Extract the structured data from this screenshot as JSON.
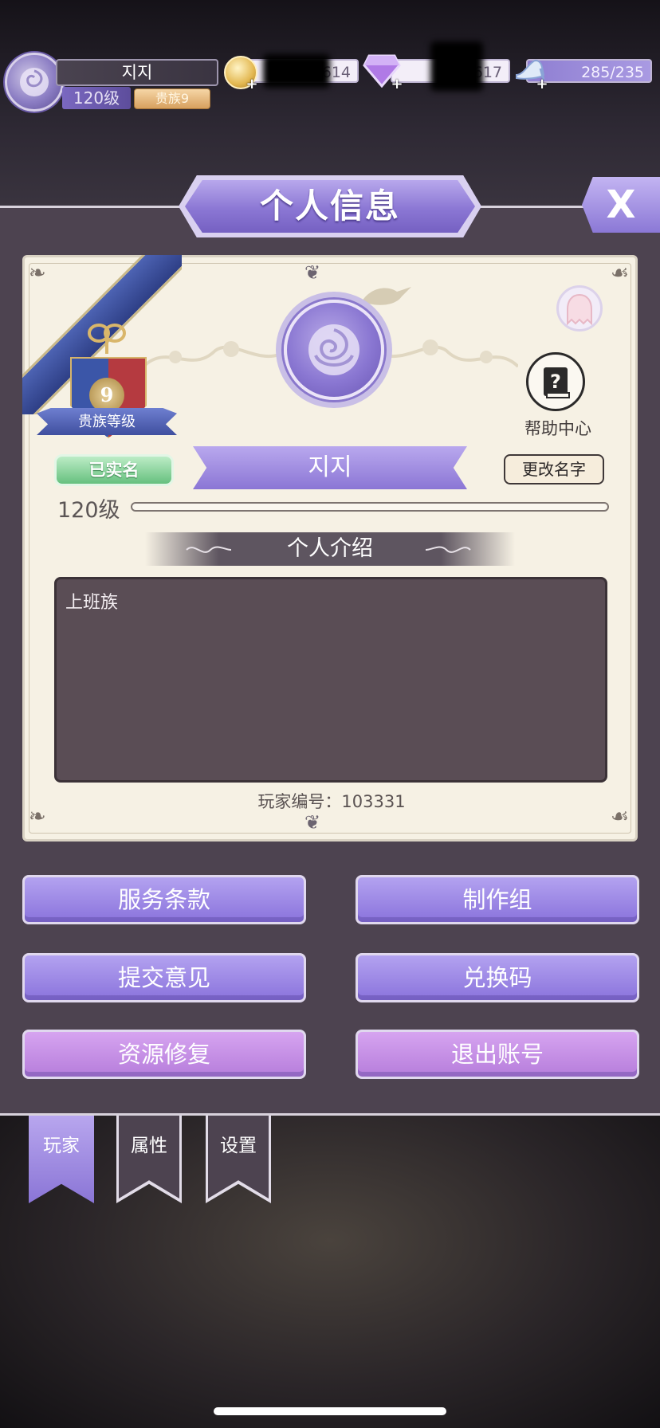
{
  "hud": {
    "name": "지지",
    "level": "120级",
    "vip": "贵族9",
    "gold": "269614",
    "gems": "4617",
    "stamina": "285/235"
  },
  "header": {
    "title": "个人信息",
    "close": "X"
  },
  "profile": {
    "noble_level_number": "9",
    "noble_level_label": "贵族等级",
    "verified_label": "已实名",
    "name": "지지",
    "rename_label": "更改名字",
    "help_label": "帮助中心",
    "level": "120级",
    "intro_title": "个人介绍",
    "intro_text": "上班族",
    "player_id": "玩家编号：103331"
  },
  "buttons": [
    {
      "label": "服务条款"
    },
    {
      "label": "制作组"
    },
    {
      "label": "提交意见"
    },
    {
      "label": "兑换码"
    },
    {
      "label": "资源修复"
    },
    {
      "label": "退出账号"
    }
  ],
  "tabs": [
    {
      "label": "玩家",
      "active": true
    },
    {
      "label": "属性",
      "active": false
    },
    {
      "label": "设置",
      "active": false
    }
  ],
  "colors": {
    "accent": "#8b77d4",
    "panel": "#4d4350",
    "card": "#f6f1e4",
    "verified": "#66c07e"
  },
  "icons": [
    "rose-icon",
    "coin-icon",
    "gem-icon",
    "glass-slipper-icon",
    "help-book-icon",
    "ghost-icon",
    "bird-icon"
  ]
}
